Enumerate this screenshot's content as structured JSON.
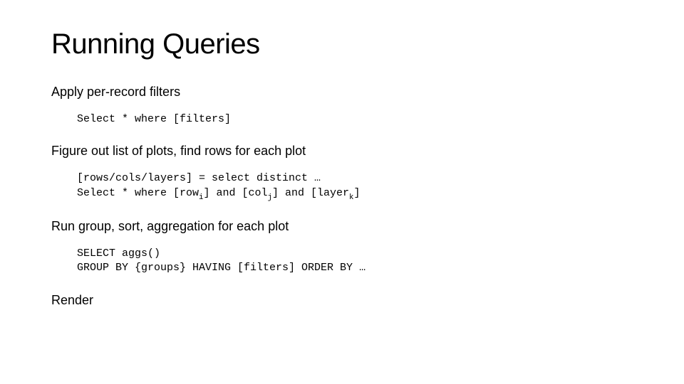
{
  "title": "Running Queries",
  "steps": {
    "s1": {
      "label": "Apply per-record filters"
    },
    "s2": {
      "label": "Figure out list of plots, find rows for each plot"
    },
    "s3": {
      "label": "Run group, sort, aggregation for each plot"
    },
    "s4": {
      "label": "Render"
    }
  },
  "code": {
    "c1": "Select * where [filters]",
    "c2_l1_pre": "[rows/cols/layers] = select distinct …",
    "c2_l2_a": "Select * where [row",
    "c2_l2_b": "] and [col",
    "c2_l2_c": "] and [layer",
    "c2_l2_d": "]",
    "sub_i": "i",
    "sub_j": "j",
    "sub_k": "k",
    "c3_l1": "SELECT aggs()",
    "c3_l2": "GROUP BY {groups} HAVING [filters] ORDER BY …"
  }
}
